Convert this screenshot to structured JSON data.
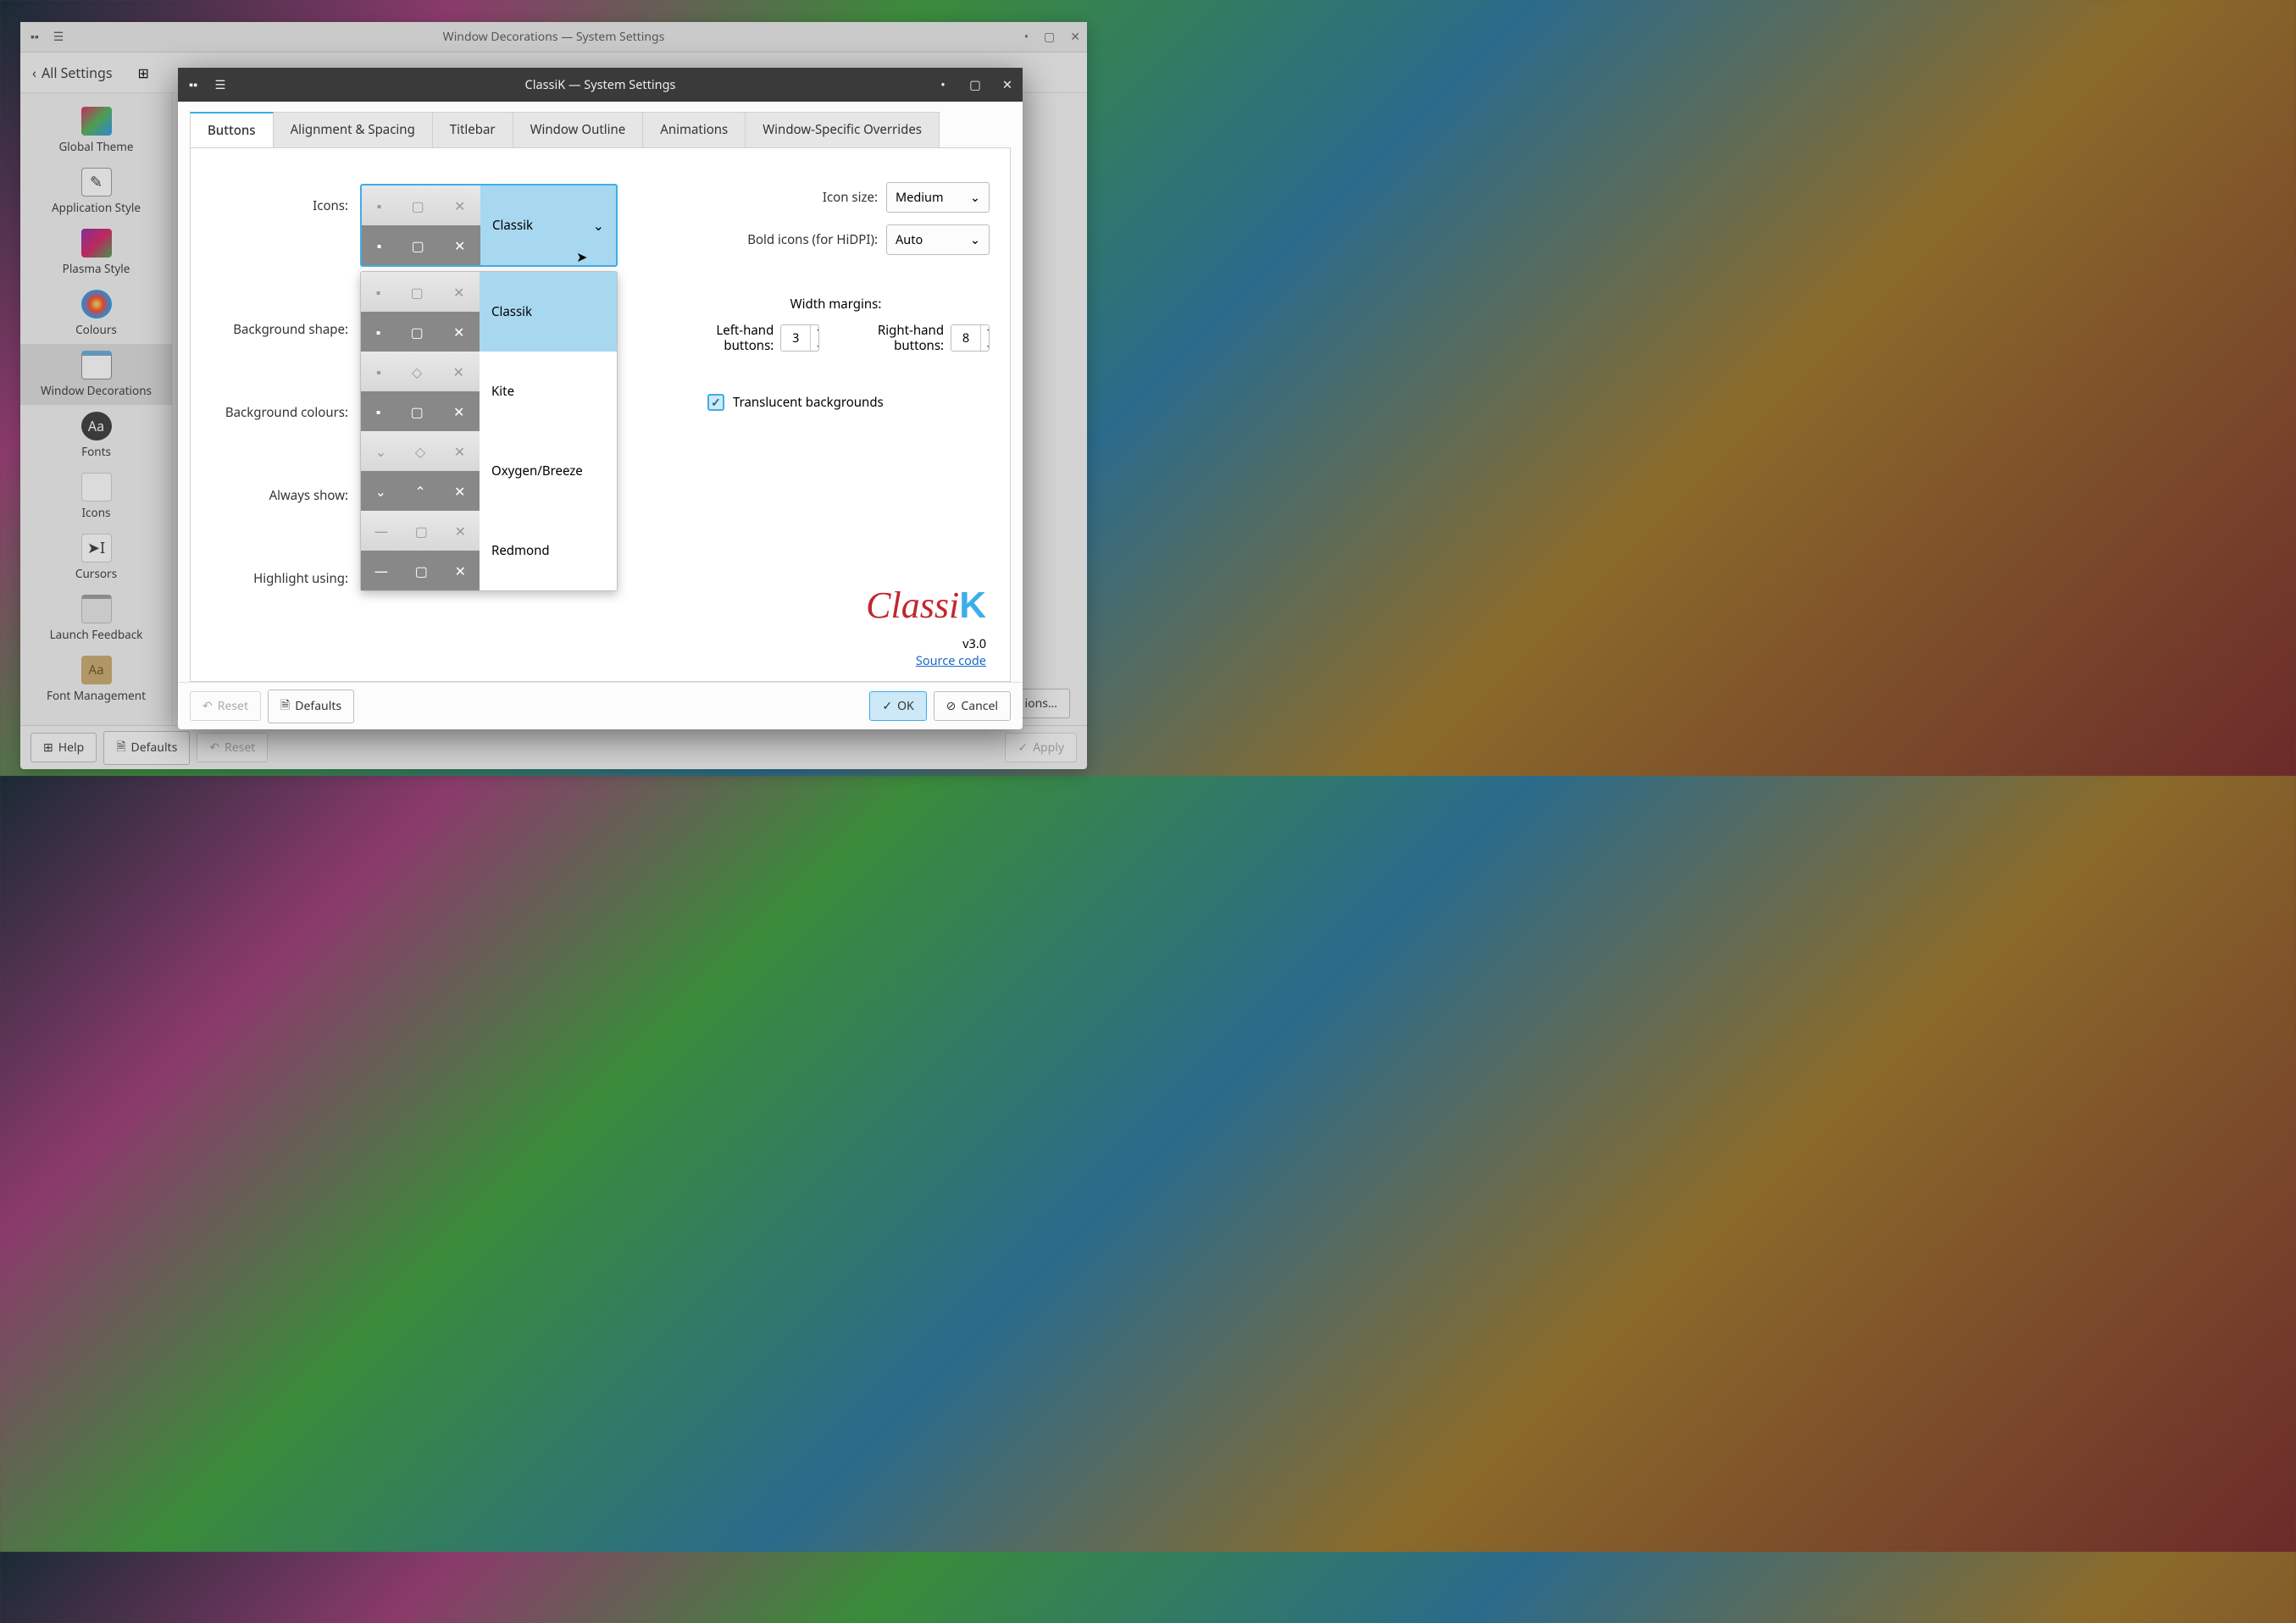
{
  "parent_window": {
    "title": "Window Decorations — System Settings",
    "back": "All Settings",
    "footer": {
      "help": "Help",
      "defaults": "Defaults",
      "reset": "Reset",
      "apply": "Apply"
    }
  },
  "sidebar": {
    "items": [
      {
        "label": "Global Theme"
      },
      {
        "label": "Application Style"
      },
      {
        "label": "Plasma Style"
      },
      {
        "label": "Colours"
      },
      {
        "label": "Window Decorations"
      },
      {
        "label": "Fonts"
      },
      {
        "label": "Icons"
      },
      {
        "label": "Cursors"
      },
      {
        "label": "Launch Feedback"
      },
      {
        "label": "Font Management"
      }
    ],
    "active_index": 4
  },
  "dialog": {
    "title": "ClassiK — System Settings",
    "tabs": [
      "Buttons",
      "Alignment & Spacing",
      "Titlebar",
      "Window Outline",
      "Animations",
      "Window-Specific Overrides"
    ],
    "active_tab": 0,
    "labels": {
      "icons": "Icons:",
      "background_shape": "Background shape:",
      "background_colours": "Background colours:",
      "always_show": "Always show:",
      "highlight_using": "Highlight using:"
    },
    "icon_options": [
      "Classik",
      "Kite",
      "Oxygen/Breeze",
      "Redmond"
    ],
    "icon_selected": "Classik",
    "right": {
      "icon_size_label": "Icon size:",
      "icon_size_value": "Medium",
      "bold_icons_label": "Bold icons (for HiDPI):",
      "bold_icons_value": "Auto",
      "width_margins_label": "Width margins:",
      "left_hand_label": "Left-hand buttons:",
      "left_hand_value": "3",
      "right_hand_label": "Right-hand buttons:",
      "right_hand_value": "8",
      "translucent_label": "Translucent backgrounds",
      "translucent_checked": true
    },
    "version": "v3.0",
    "source_link": "Source code",
    "footer": {
      "reset": "Reset",
      "defaults": "Defaults",
      "ok": "OK",
      "cancel": "Cancel"
    }
  },
  "truncated_button": "ions…"
}
